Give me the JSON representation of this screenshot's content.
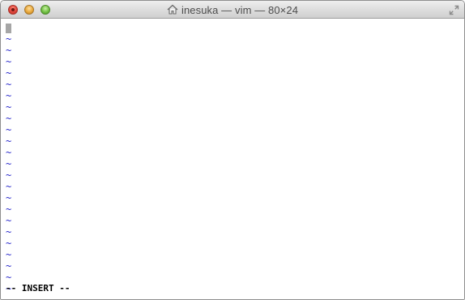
{
  "window": {
    "title": "inesuka — vim — 80×24",
    "title_icon": "home-icon",
    "controls": [
      "close",
      "minimize",
      "zoom"
    ],
    "resize_icon": "fullscreen-arrows-icon"
  },
  "editor": {
    "empty_line_marker": "~",
    "empty_line_count": 23,
    "status": "-- INSERT --",
    "colors": {
      "tilde": "#2a2acb",
      "cursor": "#a6a6a6",
      "background": "#ffffff"
    }
  }
}
